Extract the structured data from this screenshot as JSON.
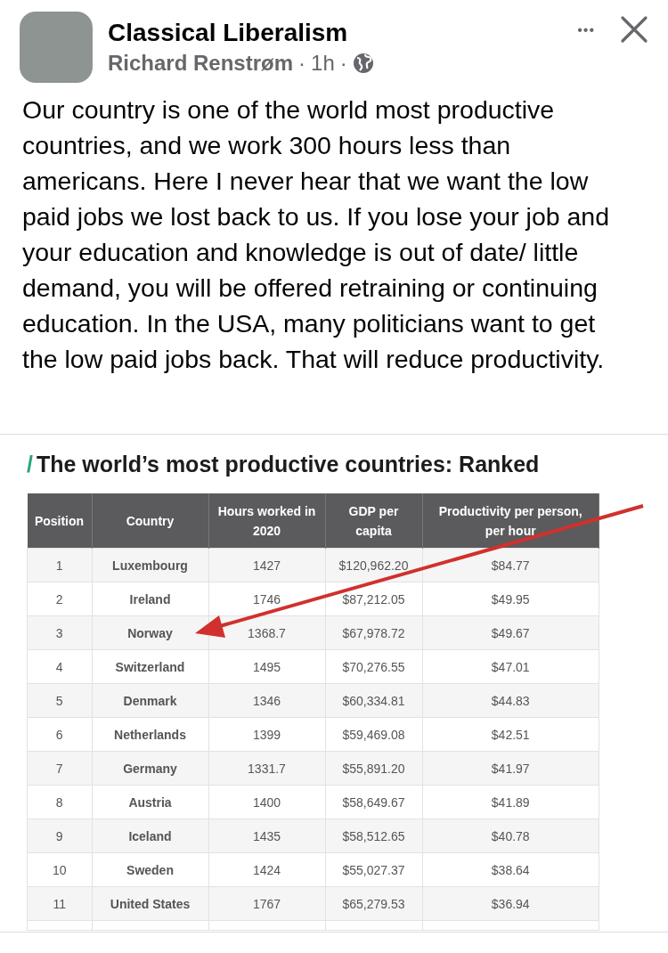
{
  "post": {
    "page_name": "Classical Liberalism",
    "author": "Richard Renstrøm",
    "separator_1": "·",
    "time": "1h",
    "separator_2": "·",
    "more_button": "•••",
    "text": "Our country is one of the world most productive countries, and we work 300 hours less than americans. Here I never hear that we want the low paid jobs we lost back to us. If you lose your job and your education and knowledge is out of date/ little demand, you will be offered retraining or continuing education. In the USA, many politicians want to get the low paid jobs back. That will reduce productivity."
  },
  "image": {
    "title_mark": "/",
    "title": "The world’s most productive countries: Ranked",
    "table": {
      "columns": [
        "Position",
        "Country",
        "Hours worked in 2020",
        "GDP per capita",
        "Productivity per person, per hour"
      ],
      "rows": [
        [
          "1",
          "Luxembourg",
          "1427",
          "$120,962.20",
          "$84.77"
        ],
        [
          "2",
          "Ireland",
          "1746",
          "$87,212.05",
          "$49.95"
        ],
        [
          "3",
          "Norway",
          "1368.7",
          "$67,978.72",
          "$49.67"
        ],
        [
          "4",
          "Switzerland",
          "1495",
          "$70,276.55",
          "$47.01"
        ],
        [
          "5",
          "Denmark",
          "1346",
          "$60,334.81",
          "$44.83"
        ],
        [
          "6",
          "Netherlands",
          "1399",
          "$59,469.08",
          "$42.51"
        ],
        [
          "7",
          "Germany",
          "1331.7",
          "$55,891.20",
          "$41.97"
        ],
        [
          "8",
          "Austria",
          "1400",
          "$58,649.67",
          "$41.89"
        ],
        [
          "9",
          "Iceland",
          "1435",
          "$58,512.65",
          "$40.78"
        ],
        [
          "10",
          "Sweden",
          "1424",
          "$55,027.37",
          "$38.64"
        ],
        [
          "11",
          "United States",
          "1767",
          "$65,279.53",
          "$36.94"
        ]
      ]
    }
  }
}
